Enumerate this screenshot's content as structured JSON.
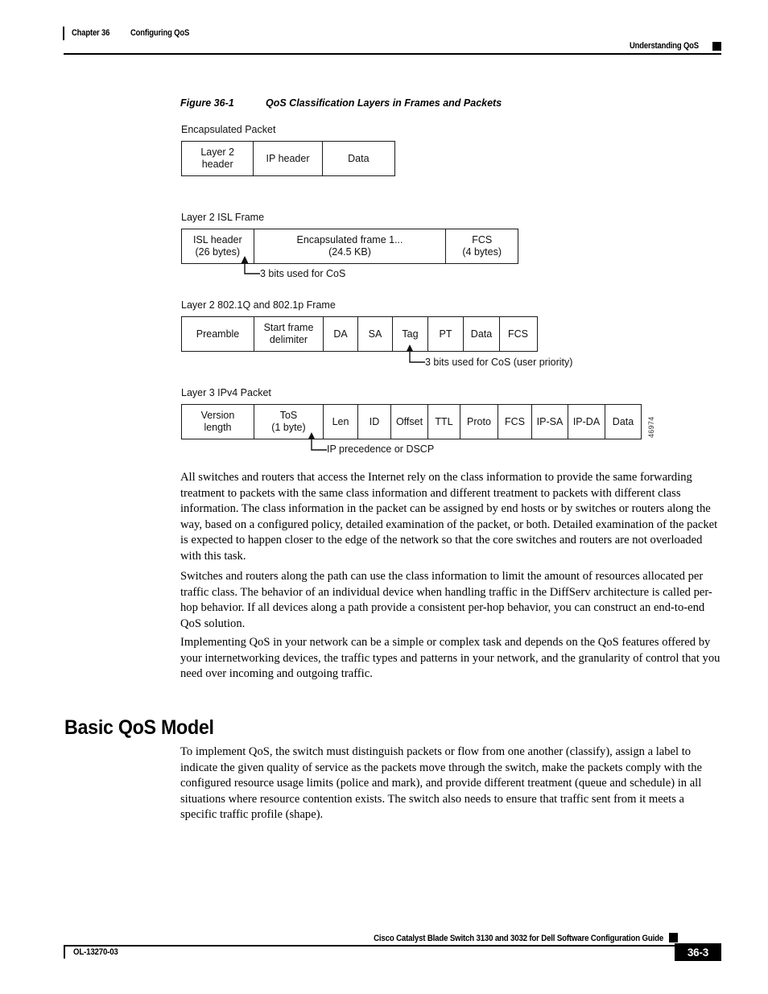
{
  "header": {
    "chapter_number": "Chapter 36",
    "chapter_title": "Configuring QoS",
    "section_title": "Understanding QoS"
  },
  "figure": {
    "number": "Figure 36-1",
    "title": "QoS Classification Layers in Frames and Packets",
    "art_id": "46974",
    "diagrams": [
      {
        "label": "Encapsulated Packet",
        "cells": [
          {
            "line1": "Layer 2",
            "line2": "header"
          },
          {
            "line1": "IP header",
            "line2": ""
          },
          {
            "line1": "Data",
            "line2": ""
          }
        ]
      },
      {
        "label": "Layer 2 ISL Frame",
        "cells": [
          {
            "line1": "ISL header",
            "line2": "(26 bytes)"
          },
          {
            "line1": "Encapsulated frame 1...",
            "line2": "(24.5 KB)"
          },
          {
            "line1": "FCS",
            "line2": "(4 bytes)"
          }
        ],
        "callout": "3 bits used for CoS"
      },
      {
        "label": "Layer 2 802.1Q and 802.1p Frame",
        "cells": [
          {
            "line1": "Preamble",
            "line2": ""
          },
          {
            "line1": "Start frame",
            "line2": "delimiter"
          },
          {
            "line1": "DA",
            "line2": ""
          },
          {
            "line1": "SA",
            "line2": ""
          },
          {
            "line1": "Tag",
            "line2": ""
          },
          {
            "line1": "PT",
            "line2": ""
          },
          {
            "line1": "Data",
            "line2": ""
          },
          {
            "line1": "FCS",
            "line2": ""
          }
        ],
        "callout": "3 bits used for CoS (user priority)"
      },
      {
        "label": "Layer 3 IPv4 Packet",
        "cells": [
          {
            "line1": "Version",
            "line2": "length"
          },
          {
            "line1": "ToS",
            "line2": "(1 byte)"
          },
          {
            "line1": "Len",
            "line2": ""
          },
          {
            "line1": "ID",
            "line2": ""
          },
          {
            "line1": "Offset",
            "line2": ""
          },
          {
            "line1": "TTL",
            "line2": ""
          },
          {
            "line1": "Proto",
            "line2": ""
          },
          {
            "line1": "FCS",
            "line2": ""
          },
          {
            "line1": "IP-SA",
            "line2": ""
          },
          {
            "line1": "IP-DA",
            "line2": ""
          },
          {
            "line1": "Data",
            "line2": ""
          }
        ],
        "callout": "IP precedence or DSCP"
      }
    ]
  },
  "body": {
    "paragraphs": [
      "All switches and routers that access the Internet rely on the class information to provide the same forwarding treatment to packets with the same class information and different treatment to packets with different class information. The class information in the packet can be assigned by end hosts or by switches or routers along the way, based on a configured policy, detailed examination of the packet, or both. Detailed examination of the packet is expected to happen closer to the edge of the network so that the core switches and routers are not overloaded with this task.",
      "Switches and routers along the path can use the class information to limit the amount of resources allocated per traffic class. The behavior of an individual device when handling traffic in the DiffServ architecture is called per-hop behavior. If all devices along a path provide a consistent per-hop behavior, you can construct an end-to-end QoS solution.",
      "Implementing QoS in your network can be a simple or complex task and depends on the QoS features offered by your internetworking devices, the traffic types and patterns in your network, and the granularity of control that you need over incoming and outgoing traffic."
    ],
    "section_heading": "Basic QoS Model",
    "section_paragraph": "To implement QoS, the switch must distinguish packets or flow from one another (classify), assign a label to indicate the given quality of service as the packets move through the switch, make the packets comply with the configured resource usage limits (police and mark), and provide different treatment (queue and schedule) in all situations where resource contention exists. The switch also needs to ensure that traffic sent from it meets a specific traffic profile (shape)."
  },
  "footer": {
    "doc_number": "OL-13270-03",
    "guide_title": "Cisco Catalyst Blade Switch 3130 and 3032 for Dell Software Configuration Guide",
    "page_number": "36-3"
  }
}
